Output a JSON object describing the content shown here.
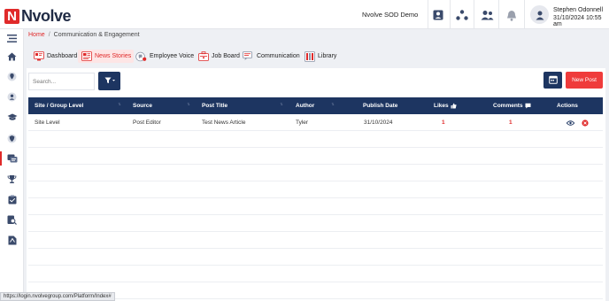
{
  "header": {
    "logo_letter": "N",
    "logo_text": "Nvolve",
    "org_name": "Nvolve SOD Demo",
    "user_name": "Stephen Odonnell",
    "user_datetime": "31/10/2024 10:55 am",
    "icons": [
      "user-card-icon",
      "network-icon",
      "users-icon",
      "bell-icon",
      "avatar-icon"
    ]
  },
  "sidebar": {
    "items": [
      "menu-icon",
      "home-icon",
      "location-icon",
      "profile-icon",
      "graduation-icon",
      "shield-icon",
      "news-icon",
      "trophy-icon",
      "clipboard-icon",
      "search-doc-icon",
      "pdf-icon"
    ],
    "active_index": 6
  },
  "breadcrumb": {
    "home": "Home",
    "separator": "/",
    "current": "Communication & Engagement"
  },
  "tabs": [
    {
      "label": "Dashboard",
      "icon": "dashboard-icon"
    },
    {
      "label": "News Stories",
      "icon": "news-icon",
      "active": true
    },
    {
      "label": "Employee Voice",
      "icon": "voice-icon"
    },
    {
      "label": "Job Board",
      "icon": "job-icon"
    },
    {
      "label": "Communication",
      "icon": "chat-icon"
    },
    {
      "label": "Library",
      "icon": "library-icon"
    }
  ],
  "toolbar": {
    "search_placeholder": "Search...",
    "filter_icon": "filter-icon",
    "new_post_label": "New Post"
  },
  "table": {
    "columns": [
      "Site / Group Level",
      "Source",
      "Post Title",
      "Author",
      "Publish Date",
      "Likes",
      "Comments",
      "Actions"
    ],
    "rows": [
      {
        "site": "Site Level",
        "source": "Post Editor",
        "title": "Test News Article",
        "author": "Tyler",
        "date": "31/10/2024",
        "likes": "1",
        "comments": "1"
      }
    ],
    "empty_rows": 10
  },
  "status_url": "https://login.nvolvegroup.com/Platform/Index#",
  "colors": {
    "brand_red": "#e02a2a",
    "navy": "#1d3561",
    "new_post_red": "#ef3b3b"
  }
}
